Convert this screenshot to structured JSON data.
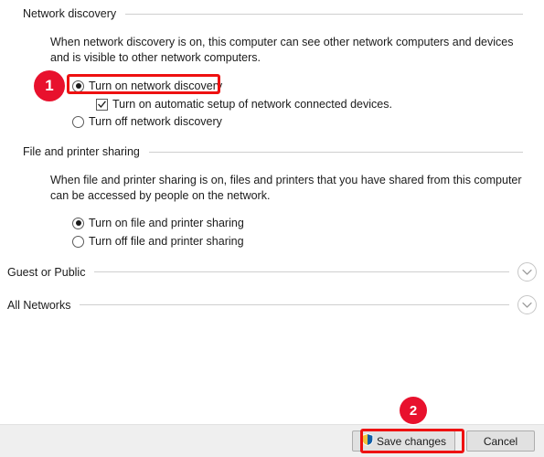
{
  "sections": [
    {
      "id": "network-discovery",
      "title": "Network discovery",
      "description": "When network discovery is on, this computer can see other network computers and devices and is visible to other network computers.",
      "options": [
        {
          "type": "radio",
          "label": "Turn on network discovery",
          "checked": true,
          "highlighted": true
        },
        {
          "type": "checkbox",
          "label": "Turn on automatic setup of network connected devices.",
          "checked": true,
          "highlighted": false
        },
        {
          "type": "radio",
          "label": "Turn off network discovery",
          "checked": false,
          "highlighted": false
        }
      ]
    },
    {
      "id": "file-and-printer-sharing",
      "title": "File and printer sharing",
      "description": "When file and printer sharing is on, files and printers that you have shared from this computer can be accessed by people on the network.",
      "options": [
        {
          "type": "radio",
          "label": "Turn on file and printer sharing",
          "checked": true,
          "highlighted": false
        },
        {
          "type": "radio",
          "label": "Turn off file and printer sharing",
          "checked": false,
          "highlighted": false
        }
      ]
    }
  ],
  "collapsed_sections": [
    {
      "id": "guest-or-public",
      "title": "Guest or Public",
      "expander_icon": "chevron-down-icon"
    },
    {
      "id": "all-networks",
      "title": "All Networks",
      "expander_icon": "chevron-down-icon"
    }
  ],
  "command_bar": {
    "save_label": "Save changes",
    "save_icon": "uac-shield-icon",
    "cancel_label": "Cancel"
  },
  "annotations": {
    "badges": [
      {
        "number": "1",
        "target": "turn-on-network-discovery-radio"
      },
      {
        "number": "2",
        "target": "save-changes-button"
      }
    ],
    "highlight_color": "#ee1111",
    "badge_color": "#e8112d"
  }
}
